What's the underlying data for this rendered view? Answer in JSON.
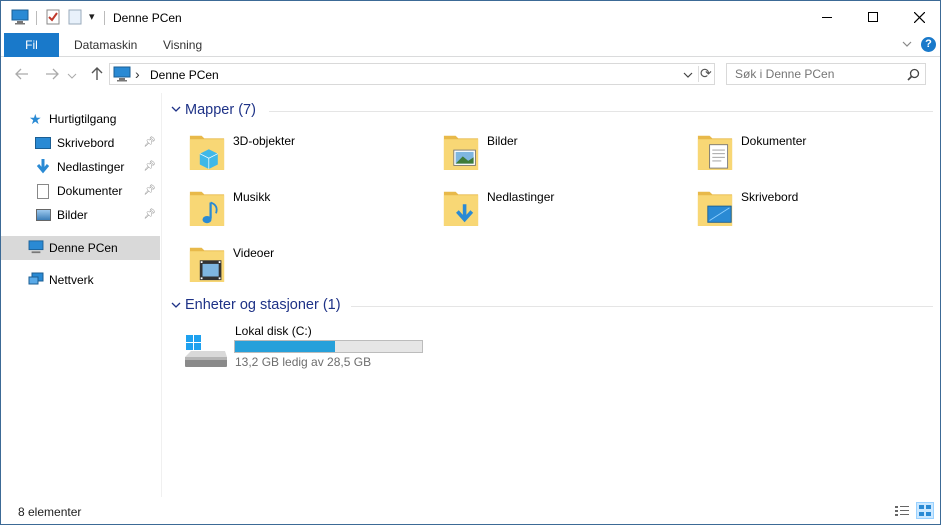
{
  "window": {
    "title": "Denne PCen",
    "qat_dropdown": "▾",
    "minimize": "—",
    "maximize": "☐",
    "close": "✕"
  },
  "ribbon": {
    "tabs": [
      "Fil",
      "Datamaskin",
      "Visning"
    ],
    "expand": "⌄",
    "help": "?"
  },
  "address": {
    "sep": "›",
    "path": "Denne PCen",
    "dropdown": "⌄",
    "refresh": "⟳"
  },
  "search": {
    "placeholder": "Søk i Denne PCen"
  },
  "sidebar": {
    "quick_access": "Hurtigtilgang",
    "quick_items": [
      "Skrivebord",
      "Nedlastinger",
      "Dokumenter",
      "Bilder"
    ],
    "this_pc": "Denne PCen",
    "network": "Nettverk"
  },
  "folders_group": {
    "header": "Mapper (7)",
    "items": [
      "3D-objekter",
      "Bilder",
      "Dokumenter",
      "Musikk",
      "Nedlastinger",
      "Skrivebord",
      "Videoer"
    ]
  },
  "devices_group": {
    "header": "Enheter og stasjoner (1)",
    "drive": {
      "name": "Lokal disk (C:)",
      "usage_text": "13,2 GB ledig av 28,5 GB",
      "used_fraction": 0.537
    }
  },
  "status": {
    "count": "8 elementer"
  },
  "colors": {
    "accent": "#1979ca",
    "header": "#1e3287",
    "selection": "#cce8ff",
    "progress": "#26a0da",
    "folder": "#f8d775"
  }
}
